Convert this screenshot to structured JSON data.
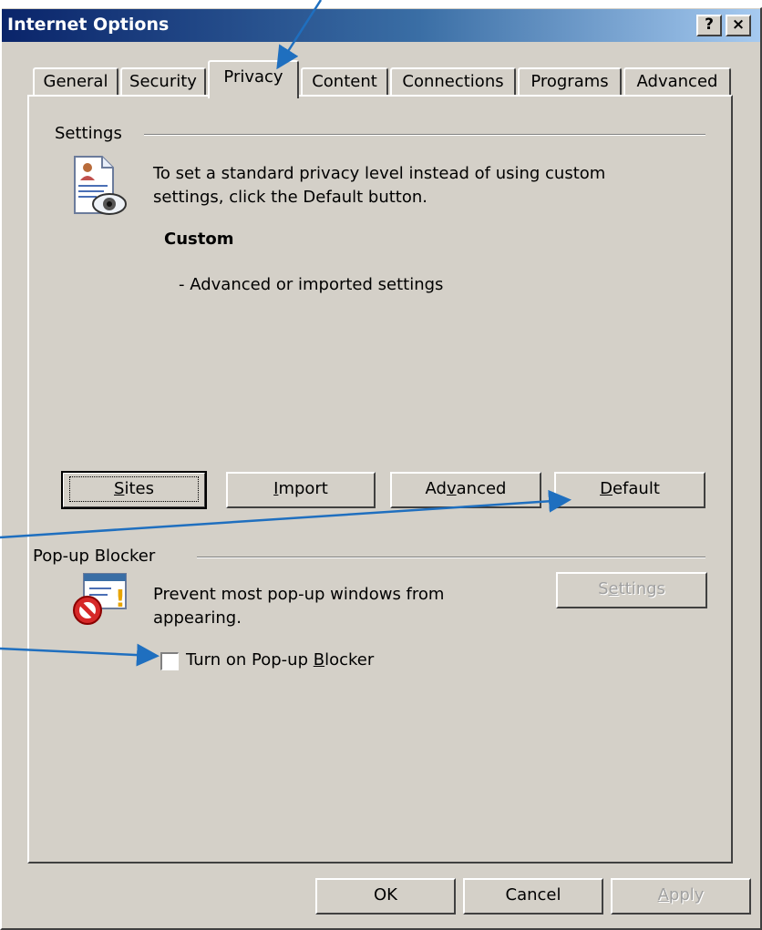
{
  "window": {
    "title": "Internet Options",
    "help_glyph": "?",
    "close_glyph": "×"
  },
  "tabs": [
    {
      "label": "General"
    },
    {
      "label": "Security"
    },
    {
      "label": "Privacy",
      "active": true
    },
    {
      "label": "Content"
    },
    {
      "label": "Connections"
    },
    {
      "label": "Programs"
    },
    {
      "label": "Advanced"
    }
  ],
  "settings_group": {
    "label": "Settings",
    "description_line1": "To set a standard privacy level instead of using custom",
    "description_line2": "settings, click the Default button.",
    "level_name": "Custom",
    "level_detail": "- Advanced or imported settings",
    "icon": "privacy-settings-icon"
  },
  "privacy_buttons": {
    "sites": {
      "before": "",
      "key": "S",
      "after": "ites"
    },
    "import": {
      "before": "",
      "key": "I",
      "after": "mport"
    },
    "advanced": {
      "before": "Ad",
      "key": "v",
      "after": "anced"
    },
    "default": {
      "before": "",
      "key": "D",
      "after": "efault"
    }
  },
  "popup_group": {
    "label": "Pop-up Blocker",
    "description_line1": "Prevent most pop-up windows from",
    "description_line2": "appearing.",
    "settings_button": {
      "before": "S",
      "key": "e",
      "after": "ttings"
    },
    "checkbox": {
      "before": "Turn on Pop-up ",
      "key": "B",
      "after": "locker",
      "checked": false
    },
    "icon": "popup-blocked-icon"
  },
  "footer_buttons": {
    "ok": "OK",
    "cancel": "Cancel",
    "apply": {
      "before": "",
      "key": "A",
      "after": "pply",
      "enabled": false
    }
  },
  "colors": {
    "dialog_face": "#d4d0c8",
    "titlebar_start": "#0a246a",
    "titlebar_end": "#a6caf0",
    "annotation_arrow": "#1f6fbf"
  }
}
